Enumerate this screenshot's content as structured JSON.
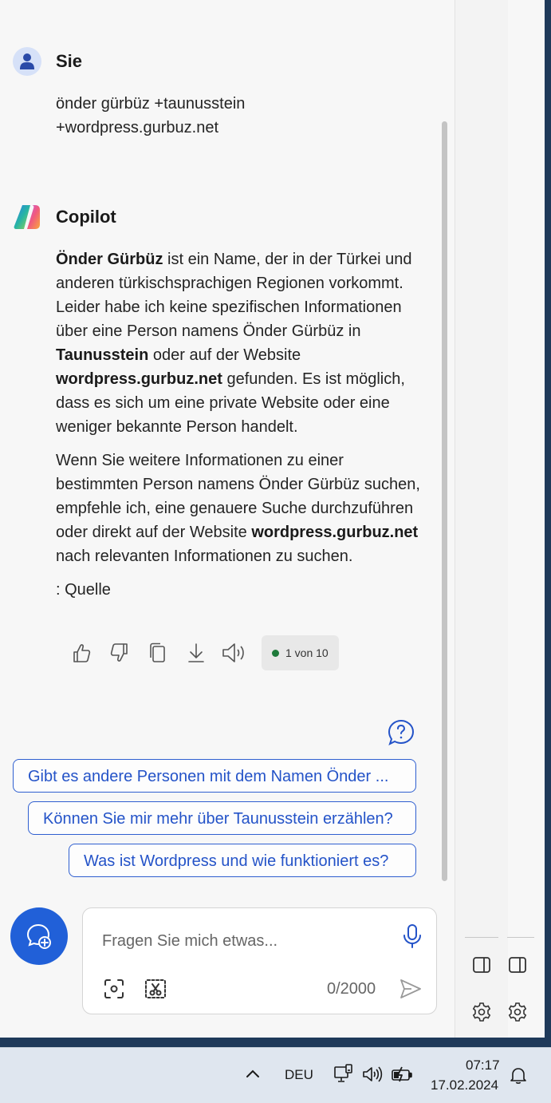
{
  "user": {
    "name": "Sie",
    "message_line1": "önder gürbüz +taunusstein",
    "message_line2": "+wordpress.gurbuz.net"
  },
  "copilot": {
    "name": "Copilot",
    "p1": [
      {
        "t": "Önder Gürbüz",
        "b": true
      },
      {
        "t": " ist ein Name, der in der Türkei und anderen türkischsprachigen Regionen vorkommt. Leider habe ich keine spezifischen Informationen über eine Person namens Önder Gürbüz in ",
        "b": false
      },
      {
        "t": "Taunusstein",
        "b": true
      },
      {
        "t": " oder auf der Website ",
        "b": false
      },
      {
        "t": "wordpress.gurbuz.net",
        "b": true
      },
      {
        "t": " gefunden. Es ist möglich, dass es sich um eine private Website oder eine weniger bekannte Person handelt.",
        "b": false
      }
    ],
    "p2": [
      {
        "t": "Wenn Sie weitere Informationen zu einer bestimmten Person namens Önder Gürbüz suchen, empfehle ich, eine genauere Suche durchzuführen oder direkt auf der Website ",
        "b": false
      },
      {
        "t": "wordpress.gurbuz.net",
        "b": true
      },
      {
        "t": " nach relevanten Informationen zu suchen.",
        "b": false
      }
    ],
    "source": ": Quelle",
    "counter": "1 von 10",
    "status_color": "#1e7a3a"
  },
  "actions": {
    "icons": [
      "thumbs-up-icon",
      "thumbs-down-icon",
      "copy-icon",
      "download-icon",
      "speaker-icon"
    ]
  },
  "suggestions": [
    "Gibt es andere Personen mit dem Namen Önder ...",
    "Können Sie mir mehr über Taunusstein erzählen?",
    "Was ist Wordpress und wie funktioniert es?"
  ],
  "input": {
    "placeholder": "Fragen Sie mich etwas...",
    "value": "",
    "char_count": "0/2000"
  },
  "taskbar": {
    "language": "DEU",
    "time": "07:17",
    "date": "17.02.2024"
  },
  "colors": {
    "accent": "#2160d8",
    "suggestion_border": "#2f5fd0",
    "panel_bg": "#f7f7f7"
  }
}
